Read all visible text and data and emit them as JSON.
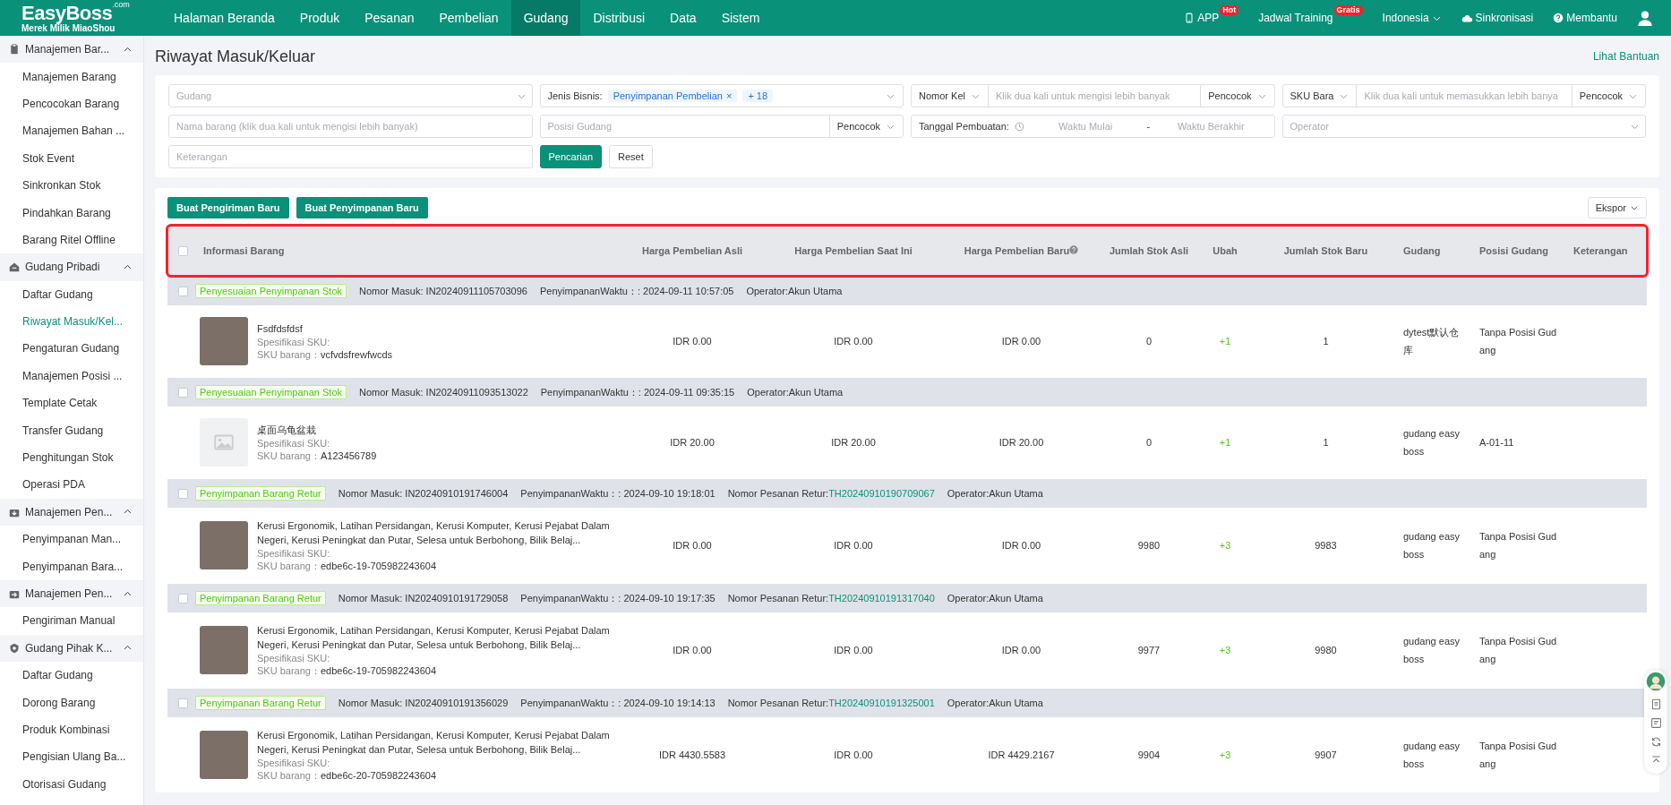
{
  "topbar": {
    "logo": "EasyBoss",
    "logo_suffix": ".com",
    "tagline": "Merek Milik MiaoShou",
    "nav": [
      {
        "label": "Halaman Beranda",
        "selected": false
      },
      {
        "label": "Produk",
        "selected": false
      },
      {
        "label": "Pesanan",
        "selected": false
      },
      {
        "label": "Pembelian",
        "selected": false
      },
      {
        "label": "Gudang",
        "selected": true
      },
      {
        "label": "Distribusi",
        "selected": false
      },
      {
        "label": "Data",
        "selected": false
      },
      {
        "label": "Sistem",
        "selected": false
      }
    ],
    "right": [
      {
        "kind": "app",
        "label": "APP",
        "badge": "Hot"
      },
      {
        "kind": "plain",
        "label": "Jadwal Training",
        "badge": "Gratis"
      },
      {
        "kind": "dropdown",
        "label": "Indonesia"
      },
      {
        "kind": "cloud",
        "label": "Sinkronisasi"
      },
      {
        "kind": "help",
        "label": "Membantu"
      },
      {
        "kind": "user"
      }
    ]
  },
  "sidebar": [
    {
      "title": "Manajemen Bar...",
      "expanded": true,
      "items": [
        {
          "label": "Manajemen Barang",
          "selected": false
        },
        {
          "label": "Pencocokan Barang",
          "selected": false
        },
        {
          "label": "Manajemen Bahan ...",
          "selected": false
        },
        {
          "label": "Stok Event",
          "selected": false
        },
        {
          "label": "Sinkronkan Stok",
          "selected": false
        },
        {
          "label": "Pindahkan Barang",
          "selected": false
        },
        {
          "label": "Barang Ritel Offline",
          "selected": false
        }
      ]
    },
    {
      "title": "Gudang Pribadi",
      "expanded": true,
      "items": [
        {
          "label": "Daftar Gudang",
          "selected": false
        },
        {
          "label": "Riwayat Masuk/Kel...",
          "selected": true
        },
        {
          "label": "Pengaturan Gudang",
          "selected": false
        },
        {
          "label": "Manajemen Posisi ...",
          "selected": false
        },
        {
          "label": "Template Cetak",
          "selected": false
        },
        {
          "label": "Transfer Gudang",
          "selected": false
        },
        {
          "label": "Penghitungan Stok",
          "selected": false
        },
        {
          "label": "Operasi PDA",
          "selected": false
        }
      ]
    },
    {
      "title": "Manajemen Pen...",
      "expanded": true,
      "items": [
        {
          "label": "Penyimpanan Man...",
          "selected": false
        },
        {
          "label": "Penyimpanan Bara...",
          "selected": false
        }
      ]
    },
    {
      "title": "Manajemen Pen...",
      "expanded": true,
      "items": [
        {
          "label": "Pengiriman Manual",
          "selected": false
        }
      ]
    },
    {
      "title": "Gudang Pihak K...",
      "expanded": true,
      "items": [
        {
          "label": "Daftar Gudang",
          "selected": false
        },
        {
          "label": "Dorong Barang",
          "selected": false
        },
        {
          "label": "Produk Kombinasi",
          "selected": false
        },
        {
          "label": "Pengisian Ulang Ba...",
          "selected": false
        },
        {
          "label": "Otorisasi Gudang",
          "selected": false
        }
      ]
    }
  ],
  "page": {
    "title": "Riwayat Masuk/Keluar",
    "help_link": "Lihat Bantuan"
  },
  "filters": {
    "warehouse": {
      "placeholder": "Gudang"
    },
    "business_type": {
      "label": "Jenis Bisnis:",
      "tags": [
        {
          "label": "Penyimpanan Pembelian",
          "remove": "×"
        }
      ],
      "more": "+ 18"
    },
    "entry_number": {
      "field": "Nomor Kel",
      "placeholder": "Klik dua kali untuk mengisi lebih banyak",
      "match": "Pencocok"
    },
    "sku": {
      "field": "SKU Bara",
      "placeholder": "Klik dua kali untuk memasukkan lebih banya",
      "match": "Pencocok"
    },
    "item_name": {
      "placeholder": "Nama barang (klik dua kali untuk mengisi lebih banyak)"
    },
    "location": {
      "placeholder": "Posisi Gudang",
      "match": "Pencocok"
    },
    "created": {
      "label": "Tanggal Pembuatan:",
      "start_placeholder": "Waktu Mulai",
      "separator": "-",
      "end_placeholder": "Waktu Berakhir"
    },
    "operator": {
      "placeholder": "Operator"
    },
    "note": {
      "placeholder": "Keterangan"
    },
    "buttons": [
      {
        "label": "Pencarian",
        "kind": "primary"
      },
      {
        "label": "Reset",
        "kind": "default"
      }
    ]
  },
  "table": {
    "actions": [
      "Buat Pengiriman Baru",
      "Buat Penyimpanan Baru"
    ],
    "export": "Ekspor",
    "header_highlighted": true,
    "select_all": {
      "checked": false
    },
    "columns": [
      {
        "label": "Informasi Barang"
      },
      {
        "label": "Harga Pembelian Asli"
      },
      {
        "label": "Harga Pembelian Saat Ini"
      },
      {
        "label": "Harga Pembelian Baru",
        "help": true
      },
      {
        "label": "Jumlah Stok Asli"
      },
      {
        "label": "Ubah"
      },
      {
        "label": "Jumlah Stok Baru"
      },
      {
        "label": "Gudang"
      },
      {
        "label": "Posisi Gudang"
      },
      {
        "label": "Keterangan"
      }
    ],
    "records": [
      {
        "checked": false,
        "tag": "Penyesuaian Penyimpanan Stok",
        "entry": "Nomor Masuk: IN20240911105703096",
        "time": "PenyimpananWaktu：: 2024-09-11 10:57:05",
        "operator": "Operator:Akun Utama",
        "has_image": true,
        "name": "Fsdfdsfdsf",
        "spec": "Spesifikasi SKU:",
        "sku_label": "SKU barang：",
        "sku": "vcfvdsfrewfwcds",
        "price_original": "IDR 0.00",
        "price_current": "IDR 0.00",
        "price_new": "IDR 0.00",
        "stock_original": "0",
        "change": "+1",
        "stock_new": "1",
        "warehouse": "dytest默认仓库",
        "location": "Tanpa Posisi Gudang"
      },
      {
        "checked": false,
        "tag": "Penyesuaian Penyimpanan Stok",
        "entry": "Nomor Masuk: IN20240911093513022",
        "time": "PenyimpananWaktu：: 2024-09-11 09:35:15",
        "operator": "Operator:Akun Utama",
        "has_image": false,
        "name": "桌面乌龟盆栽",
        "spec": "Spesifikasi SKU:",
        "sku_label": "SKU barang：",
        "sku": "A123456789",
        "price_original": "IDR 20.00",
        "price_current": "IDR 20.00",
        "price_new": "IDR 20.00",
        "stock_original": "0",
        "change": "+1",
        "stock_new": "1",
        "warehouse": "gudang easyboss",
        "location": "A-01-11"
      },
      {
        "checked": false,
        "tag": "Penyimpanan Barang Retur",
        "entry": "Nomor Masuk: IN20240910191746004",
        "time": "PenyimpananWaktu：: 2024-09-10 19:18:01",
        "return_label": "Nomor Pesanan Retur:",
        "return_number": "TH20240910190709067",
        "operator": "Operator:Akun Utama",
        "has_image": true,
        "name": "Kerusi Ergonomik, Latihan Persidangan, Kerusi Komputer, Kerusi Pejabat Dalam Negeri, Kerusi Peningkat dan Putar, Selesa untuk Berbohong, Bilik Belaj...",
        "spec": "Spesifikasi SKU:",
        "sku_label": "SKU barang：",
        "sku": "edbe6c-19-705982243604",
        "price_original": "IDR 0.00",
        "price_current": "IDR 0.00",
        "price_new": "IDR 0.00",
        "stock_original": "9980",
        "change": "+3",
        "stock_new": "9983",
        "warehouse": "gudang easyboss",
        "location": "Tanpa Posisi Gudang"
      },
      {
        "checked": false,
        "tag": "Penyimpanan Barang Retur",
        "entry": "Nomor Masuk: IN20240910191729058",
        "time": "PenyimpananWaktu：: 2024-09-10 19:17:35",
        "return_label": "Nomor Pesanan Retur:",
        "return_number": "TH20240910191317040",
        "operator": "Operator:Akun Utama",
        "has_image": true,
        "name": "Kerusi Ergonomik, Latihan Persidangan, Kerusi Komputer, Kerusi Pejabat Dalam Negeri, Kerusi Peningkat dan Putar, Selesa untuk Berbohong, Bilik Belaj...",
        "spec": "Spesifikasi SKU:",
        "sku_label": "SKU barang：",
        "sku": "edbe6c-19-705982243604",
        "price_original": "IDR 0.00",
        "price_current": "IDR 0.00",
        "price_new": "IDR 0.00",
        "stock_original": "9977",
        "change": "+3",
        "stock_new": "9980",
        "warehouse": "gudang easyboss",
        "location": "Tanpa Posisi Gudang"
      },
      {
        "checked": false,
        "tag": "Penyimpanan Barang Retur",
        "entry": "Nomor Masuk: IN20240910191356029",
        "time": "PenyimpananWaktu：: 2024-09-10 19:14:13",
        "return_label": "Nomor Pesanan Retur:",
        "return_number": "TH20240910191325001",
        "operator": "Operator:Akun Utama",
        "has_image": true,
        "name": "Kerusi Ergonomik, Latihan Persidangan, Kerusi Komputer, Kerusi Pejabat Dalam Negeri, Kerusi Peningkat dan Putar, Selesa untuk Berbohong, Bilik Belaj...",
        "spec": "Spesifikasi SKU:",
        "sku_label": "SKU barang：",
        "sku": "edbe6c-20-705982243604",
        "price_original": "IDR 4430.5583",
        "price_current": "IDR 0.00",
        "price_new": "IDR 4429.2167",
        "stock_original": "9904",
        "change": "+3",
        "stock_new": "9907",
        "warehouse": "gudang easyboss",
        "location": "Tanpa Posisi Gudang"
      }
    ]
  }
}
